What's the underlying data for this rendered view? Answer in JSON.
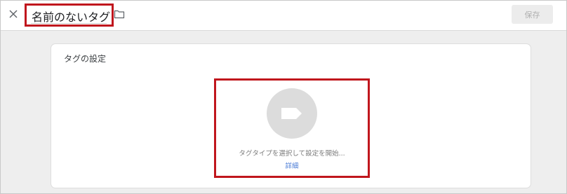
{
  "header": {
    "title": "名前のないタグ",
    "save_label": "保存",
    "icons": {
      "close": "close-icon",
      "folder": "folder-icon"
    }
  },
  "card": {
    "title": "タグの設定",
    "hint": "タグタイプを選択して設定を開始...",
    "details_link": "詳細",
    "icon": "tag-icon"
  },
  "colors": {
    "highlight": "#c0161d",
    "link": "#4a7bd6",
    "background": "#eeeeee",
    "circle": "#dcdcdc"
  }
}
